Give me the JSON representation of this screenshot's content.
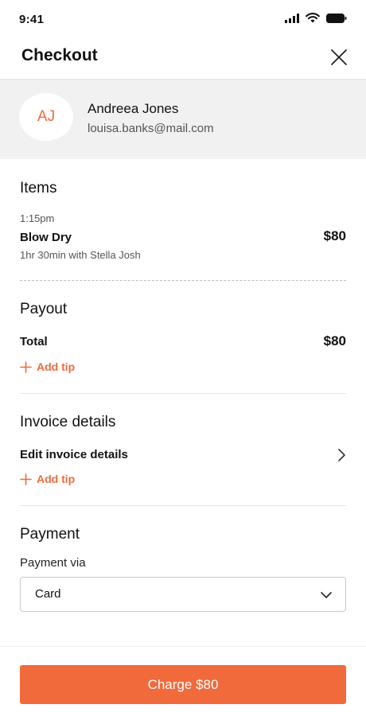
{
  "status_bar": {
    "time": "9:41"
  },
  "header": {
    "title": "Checkout"
  },
  "customer": {
    "initials": "AJ",
    "name": "Andreea Jones",
    "email": "louisa.banks@mail.com"
  },
  "items": {
    "title": "Items",
    "time": "1:15pm",
    "service": "Blow Dry",
    "details": "1hr 30min with Stella Josh",
    "price": "$80"
  },
  "payout": {
    "title": "Payout",
    "total_label": "Total",
    "total_value": "$80",
    "add_tip": "Add tip"
  },
  "invoice": {
    "title": "Invoice details",
    "edit_label": "Edit invoice details",
    "add_tip": "Add tip"
  },
  "payment": {
    "title": "Payment",
    "via_label": "Payment via",
    "selected": "Card"
  },
  "charge_button": "Charge $80",
  "colors": {
    "accent": "#f06a3c",
    "customer_bg": "#f1f1f1"
  }
}
